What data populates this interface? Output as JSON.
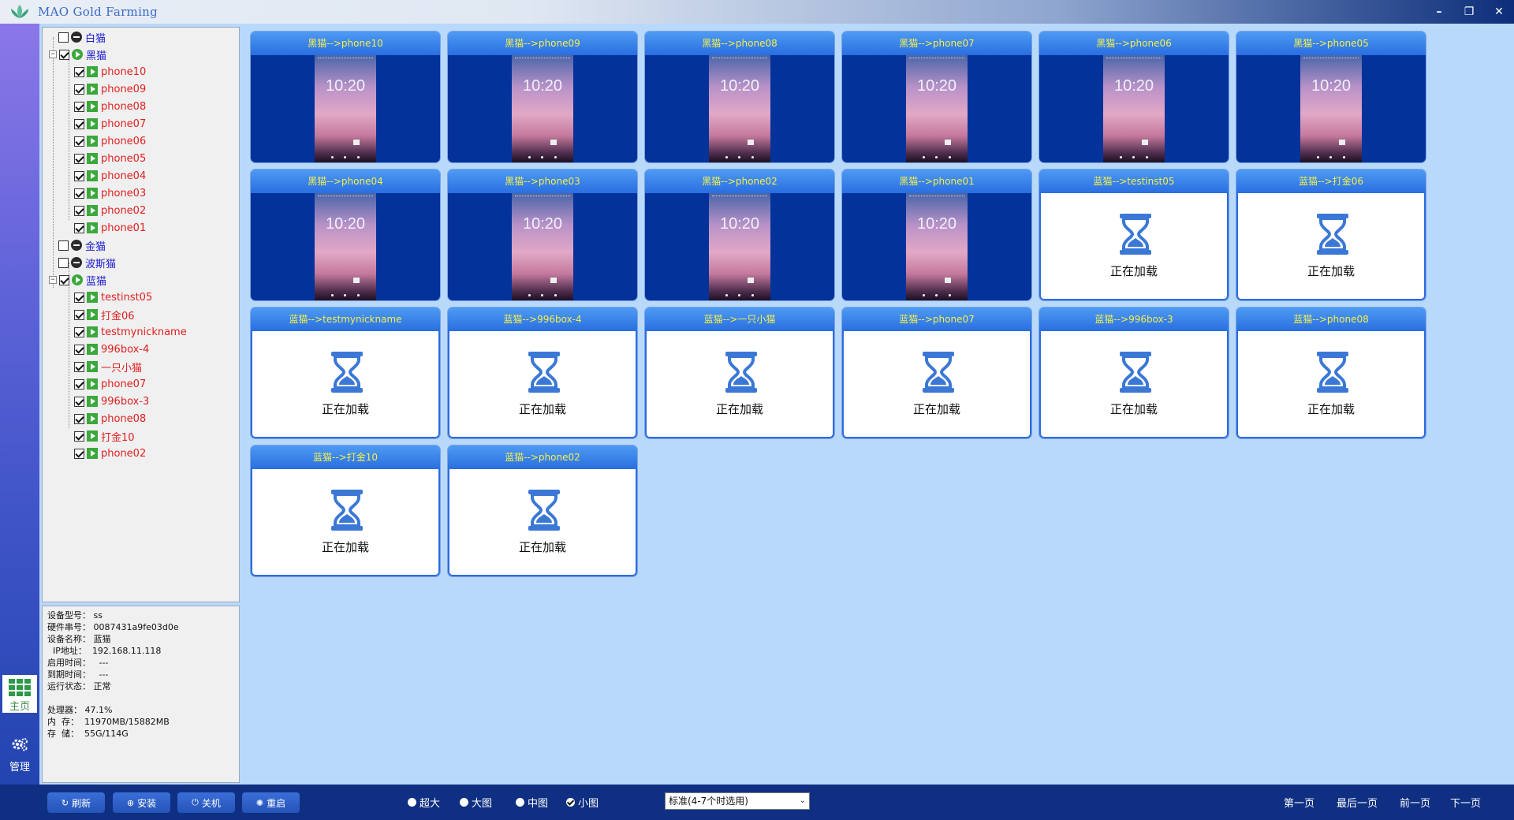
{
  "window": {
    "title": "MAO Gold Farming",
    "minimize": "–",
    "restore": "❐",
    "close": "✕"
  },
  "rail": {
    "home_label": "主页",
    "manage_label": "管理"
  },
  "tree": {
    "groups": [
      {
        "label": "白猫",
        "checked": false,
        "expanded": false,
        "devices": []
      },
      {
        "label": "黑猫",
        "checked": true,
        "expanded": true,
        "devices": [
          "phone10",
          "phone09",
          "phone08",
          "phone07",
          "phone06",
          "phone05",
          "phone04",
          "phone03",
          "phone02",
          "phone01"
        ]
      },
      {
        "label": "金猫",
        "checked": false,
        "expanded": false,
        "devices": []
      },
      {
        "label": "波斯猫",
        "checked": false,
        "expanded": false,
        "devices": []
      },
      {
        "label": "蓝猫",
        "checked": true,
        "expanded": true,
        "devices": [
          "testinst05",
          "打金06",
          "testmynickname",
          "996box-4",
          "一只小猫",
          "phone07",
          "996box-3",
          "phone08",
          "打金10",
          "phone02"
        ]
      }
    ]
  },
  "info": {
    "model": "设备型号：  ss",
    "serial": "硬件串号：  0087431a9fe03d0e",
    "name": "设备名称：  蓝猫",
    "ip": "  IP地址：  192.168.11.118",
    "start": "启用时间：   ---",
    "expire": "到期时间：   ---",
    "status": "运行状态：  正常",
    "cpu": "处理器：  47.1%",
    "memory": "内  存：  11970MB/15882MB",
    "storage": "存  储：  55G/114G"
  },
  "cards": [
    {
      "title": "黑猫-->phone10",
      "state": "phone",
      "time": "10:20"
    },
    {
      "title": "黑猫-->phone09",
      "state": "phone",
      "time": "10:20"
    },
    {
      "title": "黑猫-->phone08",
      "state": "phone",
      "time": "10:20"
    },
    {
      "title": "黑猫-->phone07",
      "state": "phone",
      "time": "10:20"
    },
    {
      "title": "黑猫-->phone06",
      "state": "phone",
      "time": "10:20"
    },
    {
      "title": "黑猫-->phone05",
      "state": "phone",
      "time": "10:20"
    },
    {
      "title": "黑猫-->phone04",
      "state": "phone",
      "time": "10:20"
    },
    {
      "title": "黑猫-->phone03",
      "state": "phone",
      "time": "10:20"
    },
    {
      "title": "黑猫-->phone02",
      "state": "phone",
      "time": "10:20"
    },
    {
      "title": "黑猫-->phone01",
      "state": "phone",
      "time": "10:20"
    },
    {
      "title": "蓝猫-->testinst05",
      "state": "loading",
      "text": "正在加载"
    },
    {
      "title": "蓝猫-->打金06",
      "state": "loading",
      "text": "正在加载"
    },
    {
      "title": "蓝猫-->testmynickname",
      "state": "loading",
      "text": "正在加载"
    },
    {
      "title": "蓝猫-->996box-4",
      "state": "loading",
      "text": "正在加载"
    },
    {
      "title": "蓝猫-->一只小猫",
      "state": "loading",
      "text": "正在加载"
    },
    {
      "title": "蓝猫-->phone07",
      "state": "loading",
      "text": "正在加载"
    },
    {
      "title": "蓝猫-->996box-3",
      "state": "loading",
      "text": "正在加载"
    },
    {
      "title": "蓝猫-->phone08",
      "state": "loading",
      "text": "正在加载"
    },
    {
      "title": "蓝猫-->打金10",
      "state": "loading",
      "text": "正在加载"
    },
    {
      "title": "蓝猫-->phone02",
      "state": "loading",
      "text": "正在加载"
    }
  ],
  "bottom": {
    "buttons": {
      "refresh": "刷新",
      "install": "安装",
      "shutdown": "关机",
      "restart": "重启"
    },
    "sizes": [
      {
        "label": "超大",
        "checked": false
      },
      {
        "label": "大图",
        "checked": false
      },
      {
        "label": "中图",
        "checked": false
      },
      {
        "label": "小图",
        "checked": true
      }
    ],
    "quality_select": "标准(4-7个时选用)",
    "pager": {
      "first": "第一页",
      "last": "最后一页",
      "prev": "前一页",
      "next": "下一页"
    }
  },
  "colors": {
    "accent": "#2a6ee0",
    "card_title": "#f5f04a",
    "phone_bg": "#04329b",
    "device_label": "#e02020",
    "group_label": "#1a1ad0",
    "bottom_bar": "#0f2f82"
  }
}
